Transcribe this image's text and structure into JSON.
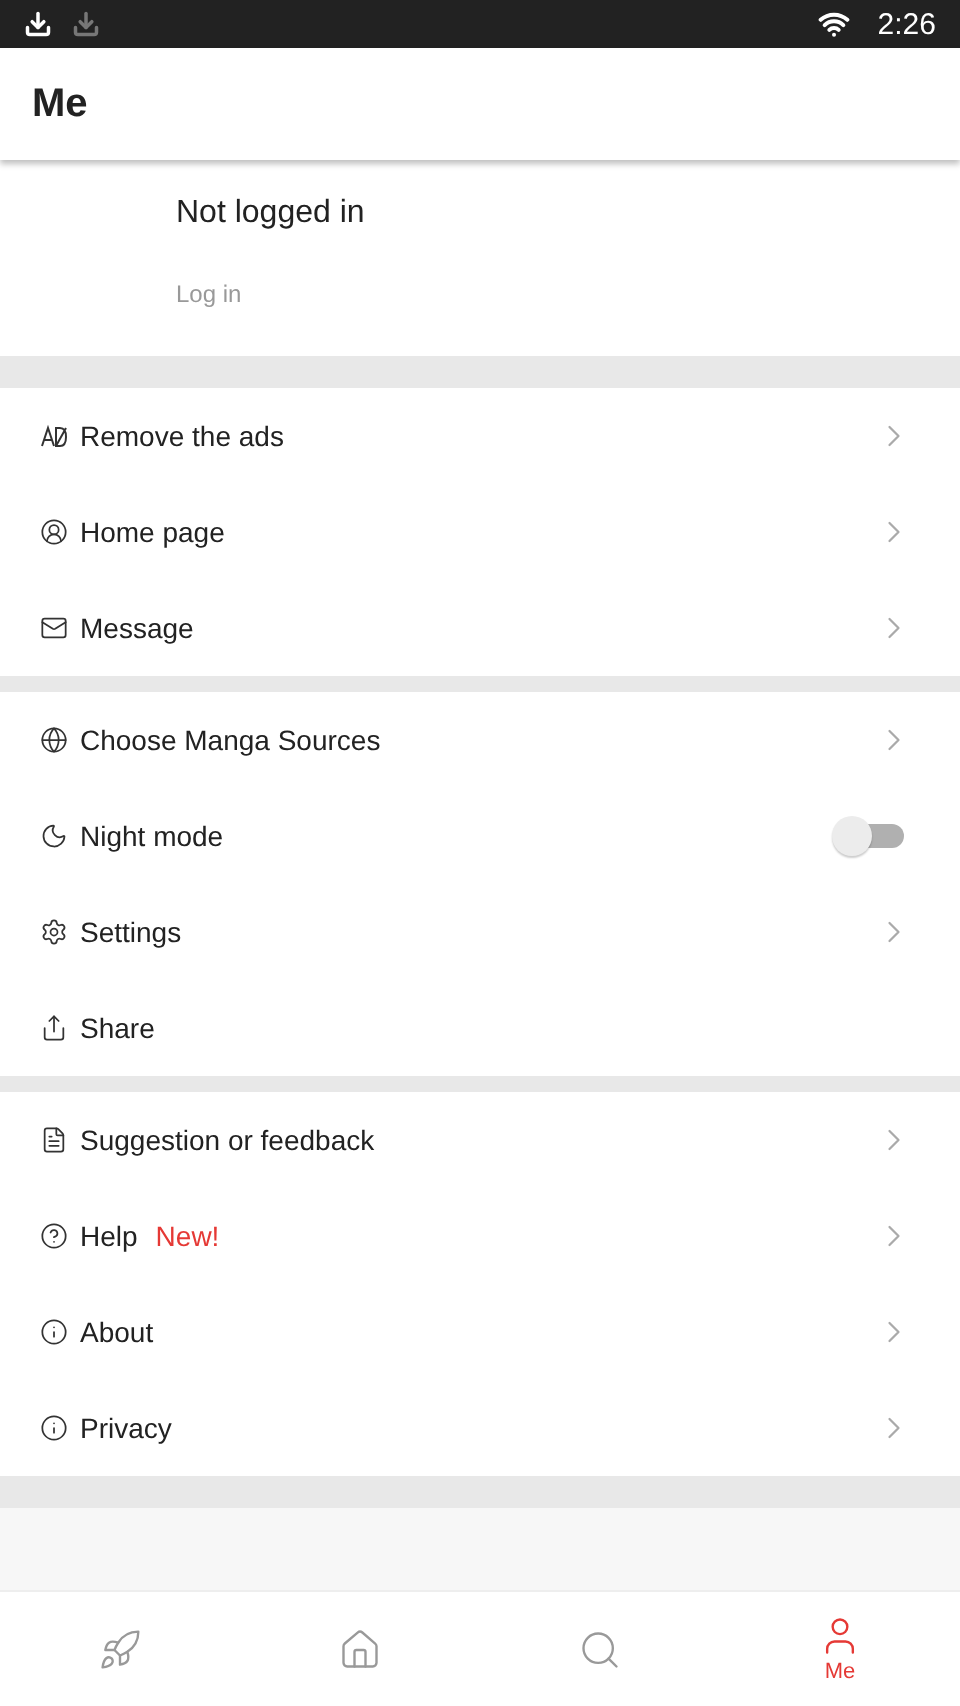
{
  "status_bar": {
    "time": "2:26"
  },
  "header": {
    "title": "Me"
  },
  "profile": {
    "name": "Not logged in",
    "action": "Log in"
  },
  "sections": [
    {
      "rows": [
        {
          "label": "Remove the ads",
          "kind": "link"
        },
        {
          "label": "Home page",
          "kind": "link"
        },
        {
          "label": "Message",
          "kind": "link"
        }
      ]
    },
    {
      "rows": [
        {
          "label": "Choose Manga Sources",
          "kind": "link"
        },
        {
          "label": "Night mode",
          "kind": "toggle",
          "on": false
        },
        {
          "label": "Settings",
          "kind": "link"
        },
        {
          "label": "Share",
          "kind": "plain"
        }
      ]
    },
    {
      "rows": [
        {
          "label": "Suggestion or feedback",
          "kind": "link"
        },
        {
          "label": "Help",
          "kind": "link",
          "badge": "New!"
        },
        {
          "label": "About",
          "kind": "link"
        },
        {
          "label": "Privacy",
          "kind": "link"
        }
      ]
    }
  ],
  "bottom_nav": [
    {
      "selected": false
    },
    {
      "selected": false
    },
    {
      "selected": false
    },
    {
      "selected": true,
      "label": "Me"
    }
  ]
}
